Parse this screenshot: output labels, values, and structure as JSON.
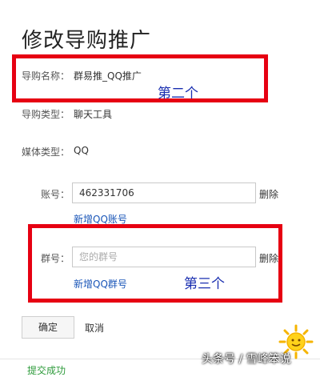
{
  "page": {
    "title": "修改导购推广"
  },
  "form": {
    "name_label": "导购名称：",
    "name_value": "群易推_QQ推广",
    "type_label": "导购类型：",
    "type_value": "聊天工具",
    "media_label": "媒体类型：",
    "media_value": "QQ",
    "account_label": "账号：",
    "account_value": "462331706",
    "account_delete": "删除",
    "add_account": "新增QQ账号",
    "group_label": "群号：",
    "group_placeholder": "您的群号",
    "group_delete": "删除",
    "add_group": "新增QQ群号"
  },
  "actions": {
    "confirm": "确定",
    "cancel": "取消"
  },
  "annotations": {
    "second": "第二个",
    "third": "第三个"
  },
  "footer": {
    "fragment": "提交成功",
    "right_fragment": "[c",
    "watermark": "头条号 / 雪峰笨说"
  },
  "colors": {
    "highlight_box": "#e60012",
    "annotation_text": "#1a2fb0",
    "link": "#1a56b8"
  }
}
